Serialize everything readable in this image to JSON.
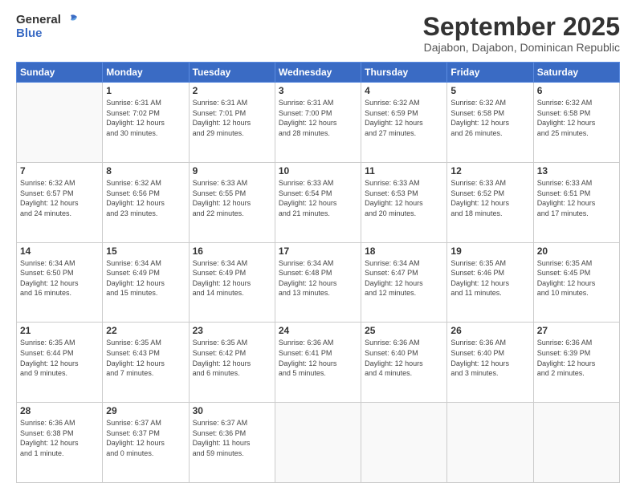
{
  "header": {
    "logo_line1": "General",
    "logo_line2": "Blue",
    "month": "September 2025",
    "location": "Dajabon, Dajabon, Dominican Republic"
  },
  "weekdays": [
    "Sunday",
    "Monday",
    "Tuesday",
    "Wednesday",
    "Thursday",
    "Friday",
    "Saturday"
  ],
  "weeks": [
    [
      {
        "day": "",
        "info": ""
      },
      {
        "day": "1",
        "info": "Sunrise: 6:31 AM\nSunset: 7:02 PM\nDaylight: 12 hours\nand 30 minutes."
      },
      {
        "day": "2",
        "info": "Sunrise: 6:31 AM\nSunset: 7:01 PM\nDaylight: 12 hours\nand 29 minutes."
      },
      {
        "day": "3",
        "info": "Sunrise: 6:31 AM\nSunset: 7:00 PM\nDaylight: 12 hours\nand 28 minutes."
      },
      {
        "day": "4",
        "info": "Sunrise: 6:32 AM\nSunset: 6:59 PM\nDaylight: 12 hours\nand 27 minutes."
      },
      {
        "day": "5",
        "info": "Sunrise: 6:32 AM\nSunset: 6:58 PM\nDaylight: 12 hours\nand 26 minutes."
      },
      {
        "day": "6",
        "info": "Sunrise: 6:32 AM\nSunset: 6:58 PM\nDaylight: 12 hours\nand 25 minutes."
      }
    ],
    [
      {
        "day": "7",
        "info": "Sunrise: 6:32 AM\nSunset: 6:57 PM\nDaylight: 12 hours\nand 24 minutes."
      },
      {
        "day": "8",
        "info": "Sunrise: 6:32 AM\nSunset: 6:56 PM\nDaylight: 12 hours\nand 23 minutes."
      },
      {
        "day": "9",
        "info": "Sunrise: 6:33 AM\nSunset: 6:55 PM\nDaylight: 12 hours\nand 22 minutes."
      },
      {
        "day": "10",
        "info": "Sunrise: 6:33 AM\nSunset: 6:54 PM\nDaylight: 12 hours\nand 21 minutes."
      },
      {
        "day": "11",
        "info": "Sunrise: 6:33 AM\nSunset: 6:53 PM\nDaylight: 12 hours\nand 20 minutes."
      },
      {
        "day": "12",
        "info": "Sunrise: 6:33 AM\nSunset: 6:52 PM\nDaylight: 12 hours\nand 18 minutes."
      },
      {
        "day": "13",
        "info": "Sunrise: 6:33 AM\nSunset: 6:51 PM\nDaylight: 12 hours\nand 17 minutes."
      }
    ],
    [
      {
        "day": "14",
        "info": "Sunrise: 6:34 AM\nSunset: 6:50 PM\nDaylight: 12 hours\nand 16 minutes."
      },
      {
        "day": "15",
        "info": "Sunrise: 6:34 AM\nSunset: 6:49 PM\nDaylight: 12 hours\nand 15 minutes."
      },
      {
        "day": "16",
        "info": "Sunrise: 6:34 AM\nSunset: 6:49 PM\nDaylight: 12 hours\nand 14 minutes."
      },
      {
        "day": "17",
        "info": "Sunrise: 6:34 AM\nSunset: 6:48 PM\nDaylight: 12 hours\nand 13 minutes."
      },
      {
        "day": "18",
        "info": "Sunrise: 6:34 AM\nSunset: 6:47 PM\nDaylight: 12 hours\nand 12 minutes."
      },
      {
        "day": "19",
        "info": "Sunrise: 6:35 AM\nSunset: 6:46 PM\nDaylight: 12 hours\nand 11 minutes."
      },
      {
        "day": "20",
        "info": "Sunrise: 6:35 AM\nSunset: 6:45 PM\nDaylight: 12 hours\nand 10 minutes."
      }
    ],
    [
      {
        "day": "21",
        "info": "Sunrise: 6:35 AM\nSunset: 6:44 PM\nDaylight: 12 hours\nand 9 minutes."
      },
      {
        "day": "22",
        "info": "Sunrise: 6:35 AM\nSunset: 6:43 PM\nDaylight: 12 hours\nand 7 minutes."
      },
      {
        "day": "23",
        "info": "Sunrise: 6:35 AM\nSunset: 6:42 PM\nDaylight: 12 hours\nand 6 minutes."
      },
      {
        "day": "24",
        "info": "Sunrise: 6:36 AM\nSunset: 6:41 PM\nDaylight: 12 hours\nand 5 minutes."
      },
      {
        "day": "25",
        "info": "Sunrise: 6:36 AM\nSunset: 6:40 PM\nDaylight: 12 hours\nand 4 minutes."
      },
      {
        "day": "26",
        "info": "Sunrise: 6:36 AM\nSunset: 6:40 PM\nDaylight: 12 hours\nand 3 minutes."
      },
      {
        "day": "27",
        "info": "Sunrise: 6:36 AM\nSunset: 6:39 PM\nDaylight: 12 hours\nand 2 minutes."
      }
    ],
    [
      {
        "day": "28",
        "info": "Sunrise: 6:36 AM\nSunset: 6:38 PM\nDaylight: 12 hours\nand 1 minute."
      },
      {
        "day": "29",
        "info": "Sunrise: 6:37 AM\nSunset: 6:37 PM\nDaylight: 12 hours\nand 0 minutes."
      },
      {
        "day": "30",
        "info": "Sunrise: 6:37 AM\nSunset: 6:36 PM\nDaylight: 11 hours\nand 59 minutes."
      },
      {
        "day": "",
        "info": ""
      },
      {
        "day": "",
        "info": ""
      },
      {
        "day": "",
        "info": ""
      },
      {
        "day": "",
        "info": ""
      }
    ]
  ]
}
